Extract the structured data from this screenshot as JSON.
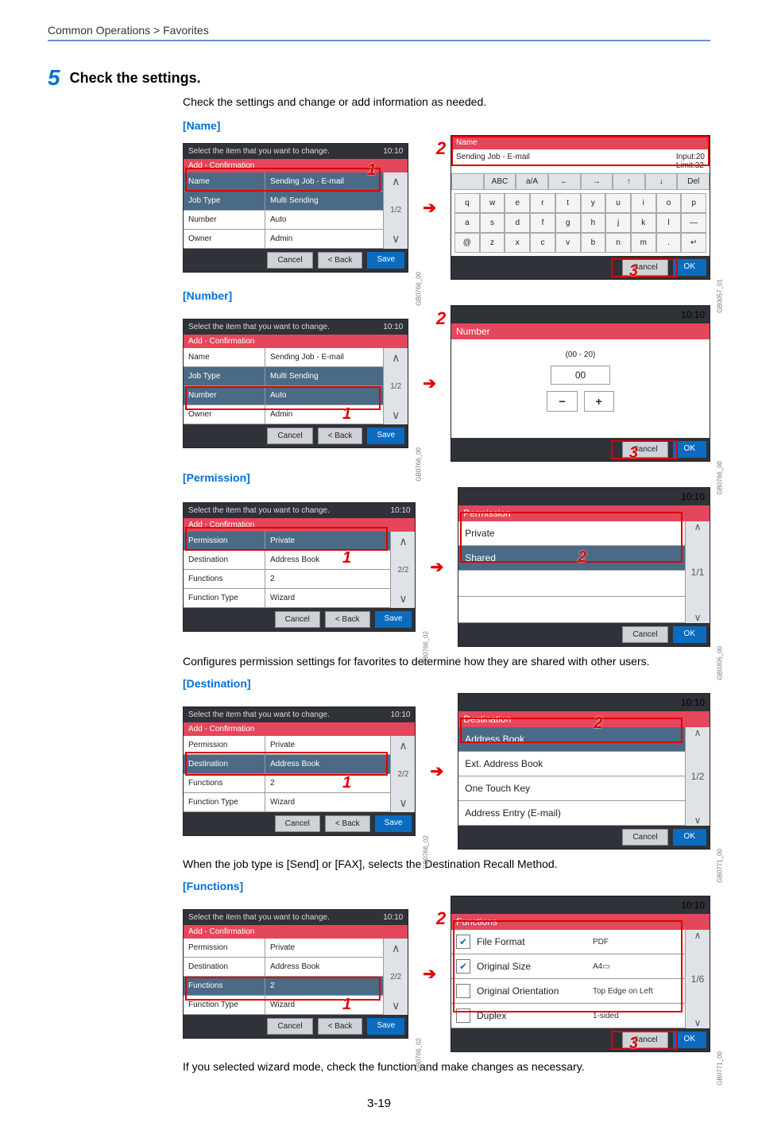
{
  "breadcrumb": "Common Operations > Favorites",
  "step": {
    "num": "5",
    "title": "Check the settings.",
    "desc": "Check the settings and change or add information as needed."
  },
  "page_num": "3-19",
  "name": {
    "label": "[Name]",
    "left": {
      "hdr": "Select the item that you want to change.",
      "time": "10:10",
      "sub": "Add - Confirmation",
      "rows": [
        [
          "Name",
          "Sending Job - E-mail"
        ],
        [
          "Job Type",
          "Multi Sending"
        ],
        [
          "Number",
          "Auto"
        ],
        [
          "Owner",
          "Admin"
        ]
      ],
      "page": "1/2",
      "cancel": "Cancel",
      "back": "< Back",
      "save": "Save",
      "tag": "GB0766_00",
      "callout": "1"
    },
    "stepnum": "2",
    "right": {
      "sub": "Name",
      "entry": "Sending Job - E-mail",
      "info1": "Input:20",
      "info2": "Limit:32",
      "modes": [
        "",
        "ABC",
        "a/A",
        "←",
        "→",
        "↑",
        "↓",
        "Del"
      ],
      "row1": [
        "q",
        "w",
        "e",
        "r",
        "t",
        "y",
        "u",
        "i",
        "o",
        "p"
      ],
      "row2": [
        "a",
        "s",
        "d",
        "f",
        "g",
        "h",
        "j",
        "k",
        "l",
        "—"
      ],
      "row3": [
        "@",
        "z",
        "x",
        "c",
        "v",
        "b",
        "n",
        "m",
        ".",
        "↵"
      ],
      "cancel": "Cancel",
      "ok": "OK",
      "callout": "3",
      "tag": "GB0057_01"
    }
  },
  "number": {
    "label": "[Number]",
    "left": {
      "hdr": "Select the item that you want to change.",
      "time": "10:10",
      "sub": "Add - Confirmation",
      "rows": [
        [
          "Name",
          "Sending Job - E-mail"
        ],
        [
          "Job Type",
          "Multi Sending"
        ],
        [
          "Number",
          "Auto"
        ],
        [
          "Owner",
          "Admin"
        ]
      ],
      "page": "1/2",
      "cancel": "Cancel",
      "back": "< Back",
      "save": "Save",
      "tag": "GB0766_00",
      "callout": "1"
    },
    "stepnum": "2",
    "right": {
      "sub": "Number",
      "time": "10:10",
      "range": "(00 - 20)",
      "value": "00",
      "minus": "−",
      "plus": "+",
      "cancel": "Cancel",
      "ok": "OK",
      "callout": "3",
      "tag": "GB0766_00"
    }
  },
  "permission": {
    "label": "[Permission]",
    "left": {
      "hdr": "Select the item that you want to change.",
      "time": "10:10",
      "sub": "Add - Confirmation",
      "rows": [
        [
          "Permission",
          "Private"
        ],
        [
          "Destination",
          "Address Book"
        ],
        [
          "Functions",
          "2"
        ],
        [
          "Function Type",
          "Wizard"
        ]
      ],
      "page": "2/2",
      "cancel": "Cancel",
      "back": "< Back",
      "save": "Save",
      "tag": "GB0766_02",
      "callout": "1"
    },
    "right": {
      "sub": "Permission",
      "time": "10:10",
      "items": [
        "Private",
        "Shared"
      ],
      "page": "1/1",
      "cancel": "Cancel",
      "ok": "OK",
      "callout": "2",
      "tag": "GB0305_00"
    },
    "desc": "Configures permission settings for favorites to determine how they are shared with other users."
  },
  "destination": {
    "label": "[Destination]",
    "left": {
      "hdr": "Select the item that you want to change.",
      "time": "10:10",
      "sub": "Add - Confirmation",
      "rows": [
        [
          "Permission",
          "Private"
        ],
        [
          "Destination",
          "Address Book"
        ],
        [
          "Functions",
          "2"
        ],
        [
          "Function Type",
          "Wizard"
        ]
      ],
      "page": "2/2",
      "cancel": "Cancel",
      "back": "< Back",
      "save": "Save",
      "tag": "GB0766_02",
      "callout": "1"
    },
    "right": {
      "sub": "Destination",
      "time": "10:10",
      "items": [
        "Address Book",
        "Ext. Address Book",
        "One Touch Key",
        "Address Entry (E-mail)"
      ],
      "page": "1/2",
      "cancel": "Cancel",
      "ok": "OK",
      "callout": "2",
      "tag": "GB0771_00"
    },
    "desc": "When the job type is [Send] or [FAX], selects the Destination Recall Method."
  },
  "functions": {
    "label": "[Functions]",
    "left": {
      "hdr": "Select the item that you want to change.",
      "time": "10:10",
      "sub": "Add - Confirmation",
      "rows": [
        [
          "Permission",
          "Private"
        ],
        [
          "Destination",
          "Address Book"
        ],
        [
          "Functions",
          "2"
        ],
        [
          "Function Type",
          "Wizard"
        ]
      ],
      "page": "2/2",
      "cancel": "Cancel",
      "back": "< Back",
      "save": "Save",
      "tag": "GB0766_02",
      "callout": "1"
    },
    "stepnum": "2",
    "right": {
      "sub": "Functions",
      "time": "10:10",
      "rows": [
        [
          "File Format",
          "PDF",
          true
        ],
        [
          "Original Size",
          "A4▭",
          true
        ],
        [
          "Original Orientation",
          "Top Edge on Left",
          false
        ],
        [
          "Duplex",
          "1-sided",
          false
        ]
      ],
      "page": "1/6",
      "cancel": "Cancel",
      "ok": "OK",
      "callout": "3",
      "tag": "GB0771_00"
    },
    "desc": "If you selected wizard mode, check the function and make changes as necessary."
  }
}
